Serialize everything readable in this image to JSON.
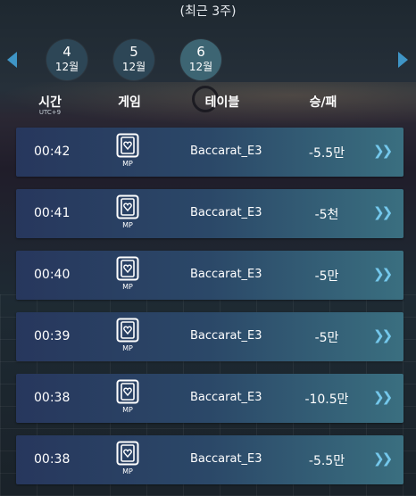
{
  "header": {
    "title": "(최근 3주)"
  },
  "dates": [
    {
      "day": "4",
      "month": "12월",
      "active": false
    },
    {
      "day": "5",
      "month": "12월",
      "active": false
    },
    {
      "day": "6",
      "month": "12월",
      "active": true
    }
  ],
  "columns": {
    "time": "시간",
    "time_sub": "UTC+9",
    "game": "게임",
    "table": "테이블",
    "result": "승/패"
  },
  "rows": [
    {
      "time": "00:42",
      "game": "MP",
      "table": "Baccarat_E3",
      "result": "-5.5만"
    },
    {
      "time": "00:41",
      "game": "MP",
      "table": "Baccarat_E3",
      "result": "-5천"
    },
    {
      "time": "00:40",
      "game": "MP",
      "table": "Baccarat_E3",
      "result": "-5만"
    },
    {
      "time": "00:39",
      "game": "MP",
      "table": "Baccarat_E3",
      "result": "-5만"
    },
    {
      "time": "00:38",
      "game": "MP",
      "table": "Baccarat_E3",
      "result": "-10.5만"
    },
    {
      "time": "00:38",
      "game": "MP",
      "table": "Baccarat_E3",
      "result": "-5.5만"
    }
  ],
  "icons": {
    "nav_prev": "triangle-left-icon",
    "nav_next": "triangle-right-icon",
    "game": "card-heart-icon",
    "row_detail": "double-chevron-right-icon"
  },
  "colors": {
    "accent": "#3f95c6",
    "chevron": "#74c8ec",
    "date_circle": "#2d4656",
    "date_circle_active": "#3d6573"
  }
}
